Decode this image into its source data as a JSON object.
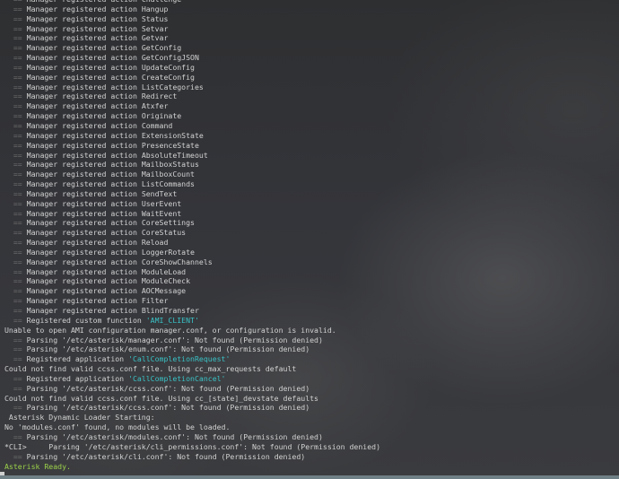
{
  "lines": [
    {
      "prefix": "  == ",
      "text": "Manager registered action Challenge"
    },
    {
      "prefix": "  == ",
      "text": "Manager registered action Hangup"
    },
    {
      "prefix": "  == ",
      "text": "Manager registered action Status"
    },
    {
      "prefix": "  == ",
      "text": "Manager registered action Setvar"
    },
    {
      "prefix": "  == ",
      "text": "Manager registered action Getvar"
    },
    {
      "prefix": "  == ",
      "text": "Manager registered action GetConfig"
    },
    {
      "prefix": "  == ",
      "text": "Manager registered action GetConfigJSON"
    },
    {
      "prefix": "  == ",
      "text": "Manager registered action UpdateConfig"
    },
    {
      "prefix": "  == ",
      "text": "Manager registered action CreateConfig"
    },
    {
      "prefix": "  == ",
      "text": "Manager registered action ListCategories"
    },
    {
      "prefix": "  == ",
      "text": "Manager registered action Redirect"
    },
    {
      "prefix": "  == ",
      "text": "Manager registered action Atxfer"
    },
    {
      "prefix": "  == ",
      "text": "Manager registered action Originate"
    },
    {
      "prefix": "  == ",
      "text": "Manager registered action Command"
    },
    {
      "prefix": "  == ",
      "text": "Manager registered action ExtensionState"
    },
    {
      "prefix": "  == ",
      "text": "Manager registered action PresenceState"
    },
    {
      "prefix": "  == ",
      "text": "Manager registered action AbsoluteTimeout"
    },
    {
      "prefix": "  == ",
      "text": "Manager registered action MailboxStatus"
    },
    {
      "prefix": "  == ",
      "text": "Manager registered action MailboxCount"
    },
    {
      "prefix": "  == ",
      "text": "Manager registered action ListCommands"
    },
    {
      "prefix": "  == ",
      "text": "Manager registered action SendText"
    },
    {
      "prefix": "  == ",
      "text": "Manager registered action UserEvent"
    },
    {
      "prefix": "  == ",
      "text": "Manager registered action WaitEvent"
    },
    {
      "prefix": "  == ",
      "text": "Manager registered action CoreSettings"
    },
    {
      "prefix": "  == ",
      "text": "Manager registered action CoreStatus"
    },
    {
      "prefix": "  == ",
      "text": "Manager registered action Reload"
    },
    {
      "prefix": "  == ",
      "text": "Manager registered action LoggerRotate"
    },
    {
      "prefix": "  == ",
      "text": "Manager registered action CoreShowChannels"
    },
    {
      "prefix": "  == ",
      "text": "Manager registered action ModuleLoad"
    },
    {
      "prefix": "  == ",
      "text": "Manager registered action ModuleCheck"
    },
    {
      "prefix": "  == ",
      "text": "Manager registered action AOCMessage"
    },
    {
      "prefix": "  == ",
      "text": "Manager registered action Filter"
    },
    {
      "prefix": "  == ",
      "text": "Manager registered action BlindTransfer"
    },
    {
      "prefix": "  == ",
      "text": "Registered custom function ",
      "hl": "'AMI_CLIENT'"
    },
    {
      "prefix": "",
      "text": "Unable to open AMI configuration manager.conf, or configuration is invalid."
    },
    {
      "prefix": "  == ",
      "text": "Parsing '/etc/asterisk/manager.conf': Not found (Permission denied)"
    },
    {
      "prefix": "  == ",
      "text": "Parsing '/etc/asterisk/enum.conf': Not found (Permission denied)"
    },
    {
      "prefix": "  == ",
      "text": "Registered application ",
      "hl": "'CallCompletionRequest'"
    },
    {
      "prefix": "",
      "text": "Could not find valid ccss.conf file. Using cc_max_requests default"
    },
    {
      "prefix": "  == ",
      "text": "Registered application ",
      "hl": "'CallCompletionCancel'"
    },
    {
      "prefix": "  == ",
      "text": "Parsing '/etc/asterisk/ccss.conf': Not found (Permission denied)"
    },
    {
      "prefix": "",
      "text": "Could not find valid ccss.conf file. Using cc_[state]_devstate defaults"
    },
    {
      "prefix": "  == ",
      "text": "Parsing '/etc/asterisk/ccss.conf': Not found (Permission denied)"
    },
    {
      "prefix": "",
      "text": " Asterisk Dynamic Loader Starting:"
    },
    {
      "prefix": "",
      "text": "No 'modules.conf' found, no modules will be loaded."
    },
    {
      "prefix": "  == ",
      "text": "Parsing '/etc/asterisk/modules.conf': Not found (Permission denied)"
    },
    {
      "prefix": "*CLI>     ",
      "text": "Parsing '/etc/asterisk/cli_permissions.conf': Not found (Permission denied)"
    },
    {
      "prefix": "  == ",
      "text": "Parsing '/etc/asterisk/cli.conf': Not found (Permission denied)"
    },
    {
      "prefix": "",
      "text": "Asterisk Ready.",
      "ready": true
    }
  ]
}
